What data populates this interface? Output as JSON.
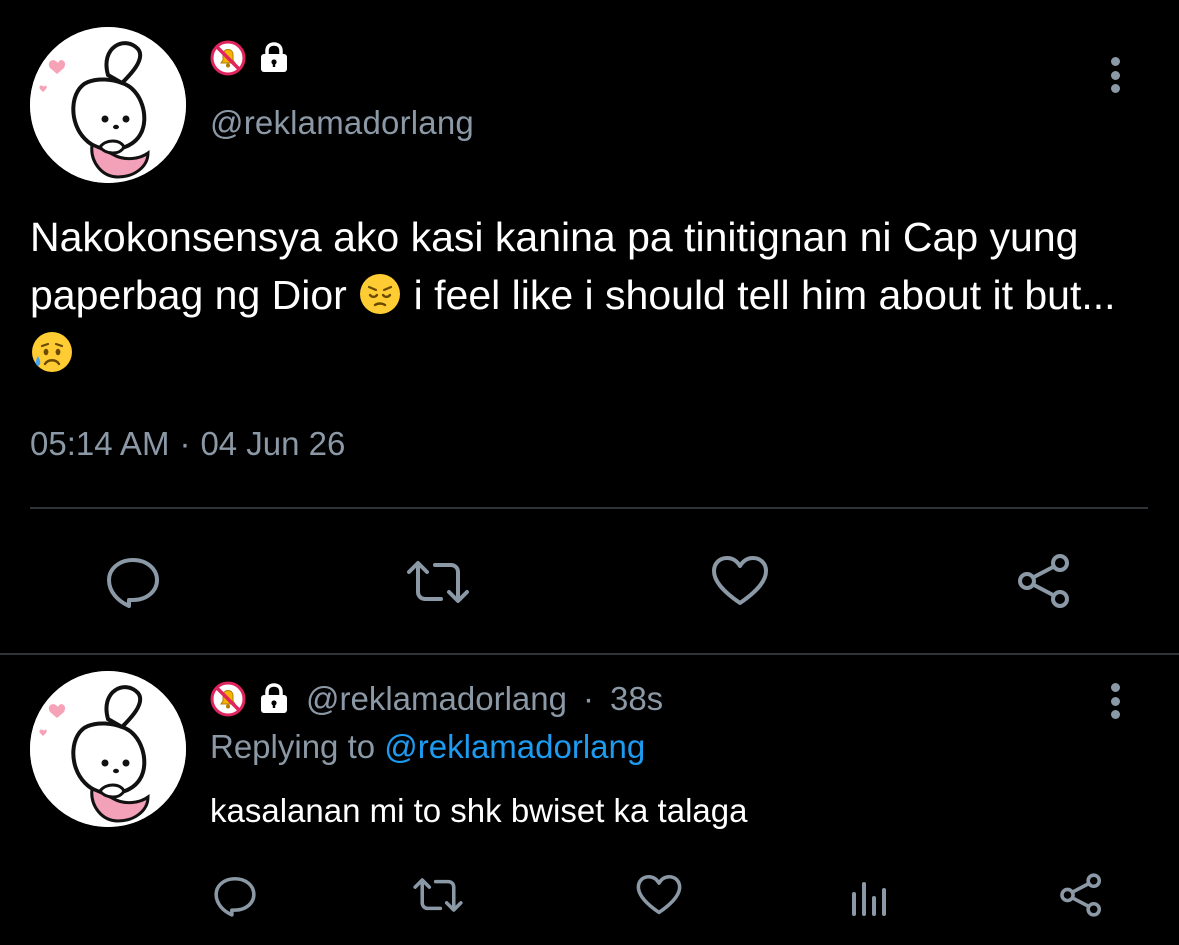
{
  "colors": {
    "background": "#000000",
    "text_primary": "#ffffff",
    "text_secondary": "#8b98a5",
    "link": "#1d9bf0",
    "divider": "#2f3336",
    "mute_badge": "#e0245e"
  },
  "main_tweet": {
    "avatar_icon": "pochacco-avatar",
    "badges": [
      "muted-bell-icon",
      "lock-icon"
    ],
    "handle": "@reklamadorlang",
    "text_part1": "Nakokonsensya ako kasi kanina pa tinitignan ni Cap yung paperbag ng Dior ",
    "emoji1": "pensive-face-emoji",
    "text_part2": " i feel like i should tell him about it but...",
    "emoji2": "sad-but-relieved-face-emoji",
    "time": "05:14 AM",
    "separator": "·",
    "date": "04 Jun 26",
    "actions": [
      "reply-icon",
      "retweet-icon",
      "like-icon",
      "share-icon"
    ]
  },
  "reply_tweet": {
    "avatar_icon": "pochacco-avatar",
    "badges": [
      "muted-bell-icon",
      "lock-icon"
    ],
    "handle": "@reklamadorlang",
    "separator": "·",
    "age": "38s",
    "replying_prefix": "Replying to ",
    "replying_handle": "@reklamadorlang",
    "text": "kasalanan mi to shk bwiset ka talaga",
    "actions": [
      "reply-icon",
      "retweet-icon",
      "like-icon",
      "analytics-icon",
      "share-icon"
    ]
  }
}
